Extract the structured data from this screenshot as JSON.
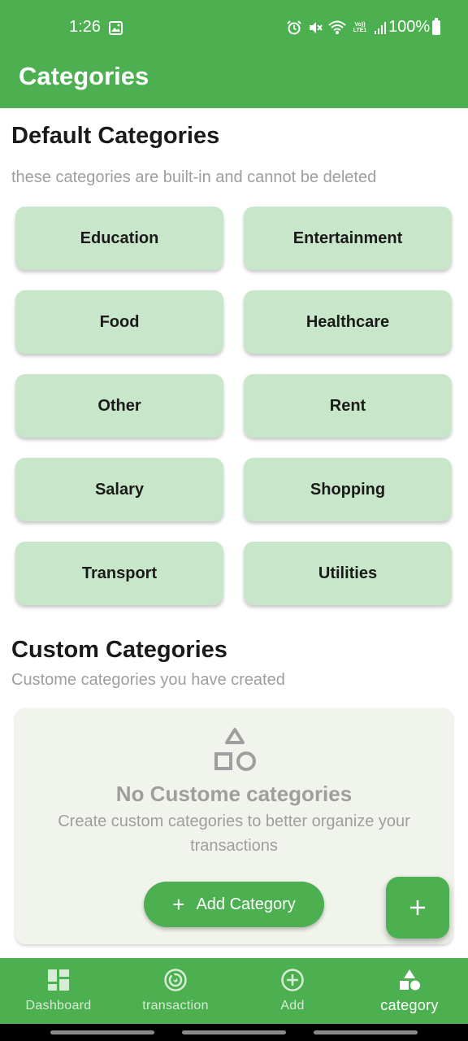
{
  "status_bar": {
    "time": "1:26",
    "battery": "100%",
    "lte_top": "Vo))",
    "lte_bottom": "LTE1"
  },
  "app_bar": {
    "title": "Categories"
  },
  "default_section": {
    "title": "Default Categories",
    "subtitle": "these categories are built-in and cannot be deleted",
    "categories": [
      "Education",
      "Entertainment",
      "Food",
      "Healthcare",
      "Other",
      "Rent",
      "Salary",
      "Shopping",
      "Transport",
      "Utilities"
    ]
  },
  "custom_section": {
    "title": "Custom Categories",
    "subtitle": "Custome categories you have created",
    "empty_title": "No Custome categories",
    "empty_desc": "Create custom categories to better organize your transactions",
    "add_button_label": "Add Category"
  },
  "fab": {
    "icon": "plus-icon"
  },
  "bottom_nav": {
    "items": [
      {
        "label": "Dashboard",
        "icon": "dashboard-icon"
      },
      {
        "label": "transaction",
        "icon": "transaction-icon"
      },
      {
        "label": "Add",
        "icon": "add-circle-icon"
      },
      {
        "label": "category",
        "icon": "category-icon"
      }
    ],
    "active_index": 3
  },
  "colors": {
    "primary": "#4caf50",
    "chip": "#c8e6c9",
    "empty_card": "#f1f4ec",
    "muted_text": "#9e9e9e"
  }
}
